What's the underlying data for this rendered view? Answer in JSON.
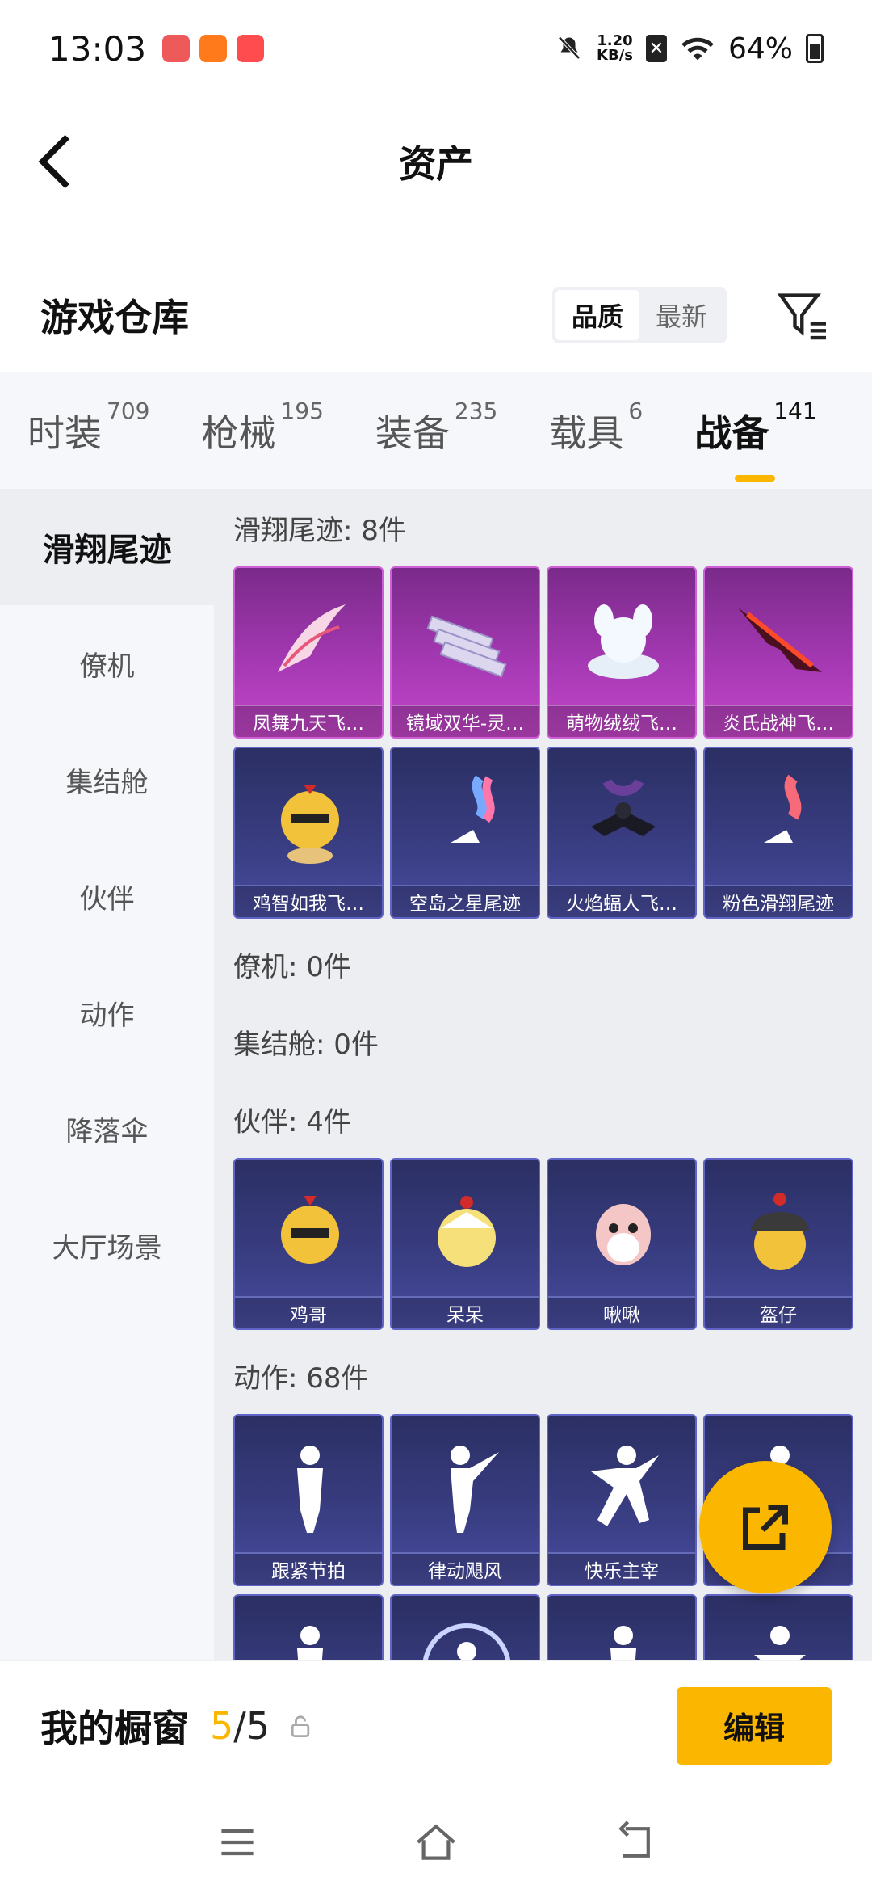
{
  "status": {
    "time": "13:03",
    "net_speed_top": "1.20",
    "net_speed_bottom": "KB/s",
    "battery": "64%"
  },
  "header": {
    "title": "资产"
  },
  "section": {
    "title": "游戏仓库",
    "sort": [
      "品质",
      "最新"
    ]
  },
  "tabs": [
    {
      "label": "时装",
      "count": "709"
    },
    {
      "label": "枪械",
      "count": "195"
    },
    {
      "label": "装备",
      "count": "235"
    },
    {
      "label": "载具",
      "count": "6"
    },
    {
      "label": "战备",
      "count": "141"
    }
  ],
  "sidenav": [
    "滑翔尾迹",
    "僚机",
    "集结舱",
    "伙伴",
    "动作",
    "降落伞",
    "大厅场景"
  ],
  "groups": {
    "trails": {
      "title": "滑翔尾迹: 8件",
      "items": [
        "凤舞九天飞…",
        "镜域双华-灵…",
        "萌物绒绒飞…",
        "炎氏战神飞…",
        "鸡智如我飞…",
        "空岛之星尾迹",
        "火焰蝠人飞…",
        "粉色滑翔尾迹"
      ]
    },
    "wingman": {
      "title": "僚机: 0件"
    },
    "pod": {
      "title": "集结舱: 0件"
    },
    "partners": {
      "title": "伙伴: 4件",
      "items": [
        "鸡哥",
        "呆呆",
        "啾啾",
        "盔仔"
      ]
    },
    "emotes": {
      "title": "动作: 68件",
      "items": [
        "跟紧节拍",
        "律动飓风",
        "快乐主宰",
        ""
      ]
    }
  },
  "bottom": {
    "label": "我的橱窗",
    "current": "5",
    "total": "/5",
    "edit": "编辑"
  },
  "colors": {
    "accent": "#fbb600",
    "purple": "#a83ab6",
    "blue": "#3b3f86"
  }
}
